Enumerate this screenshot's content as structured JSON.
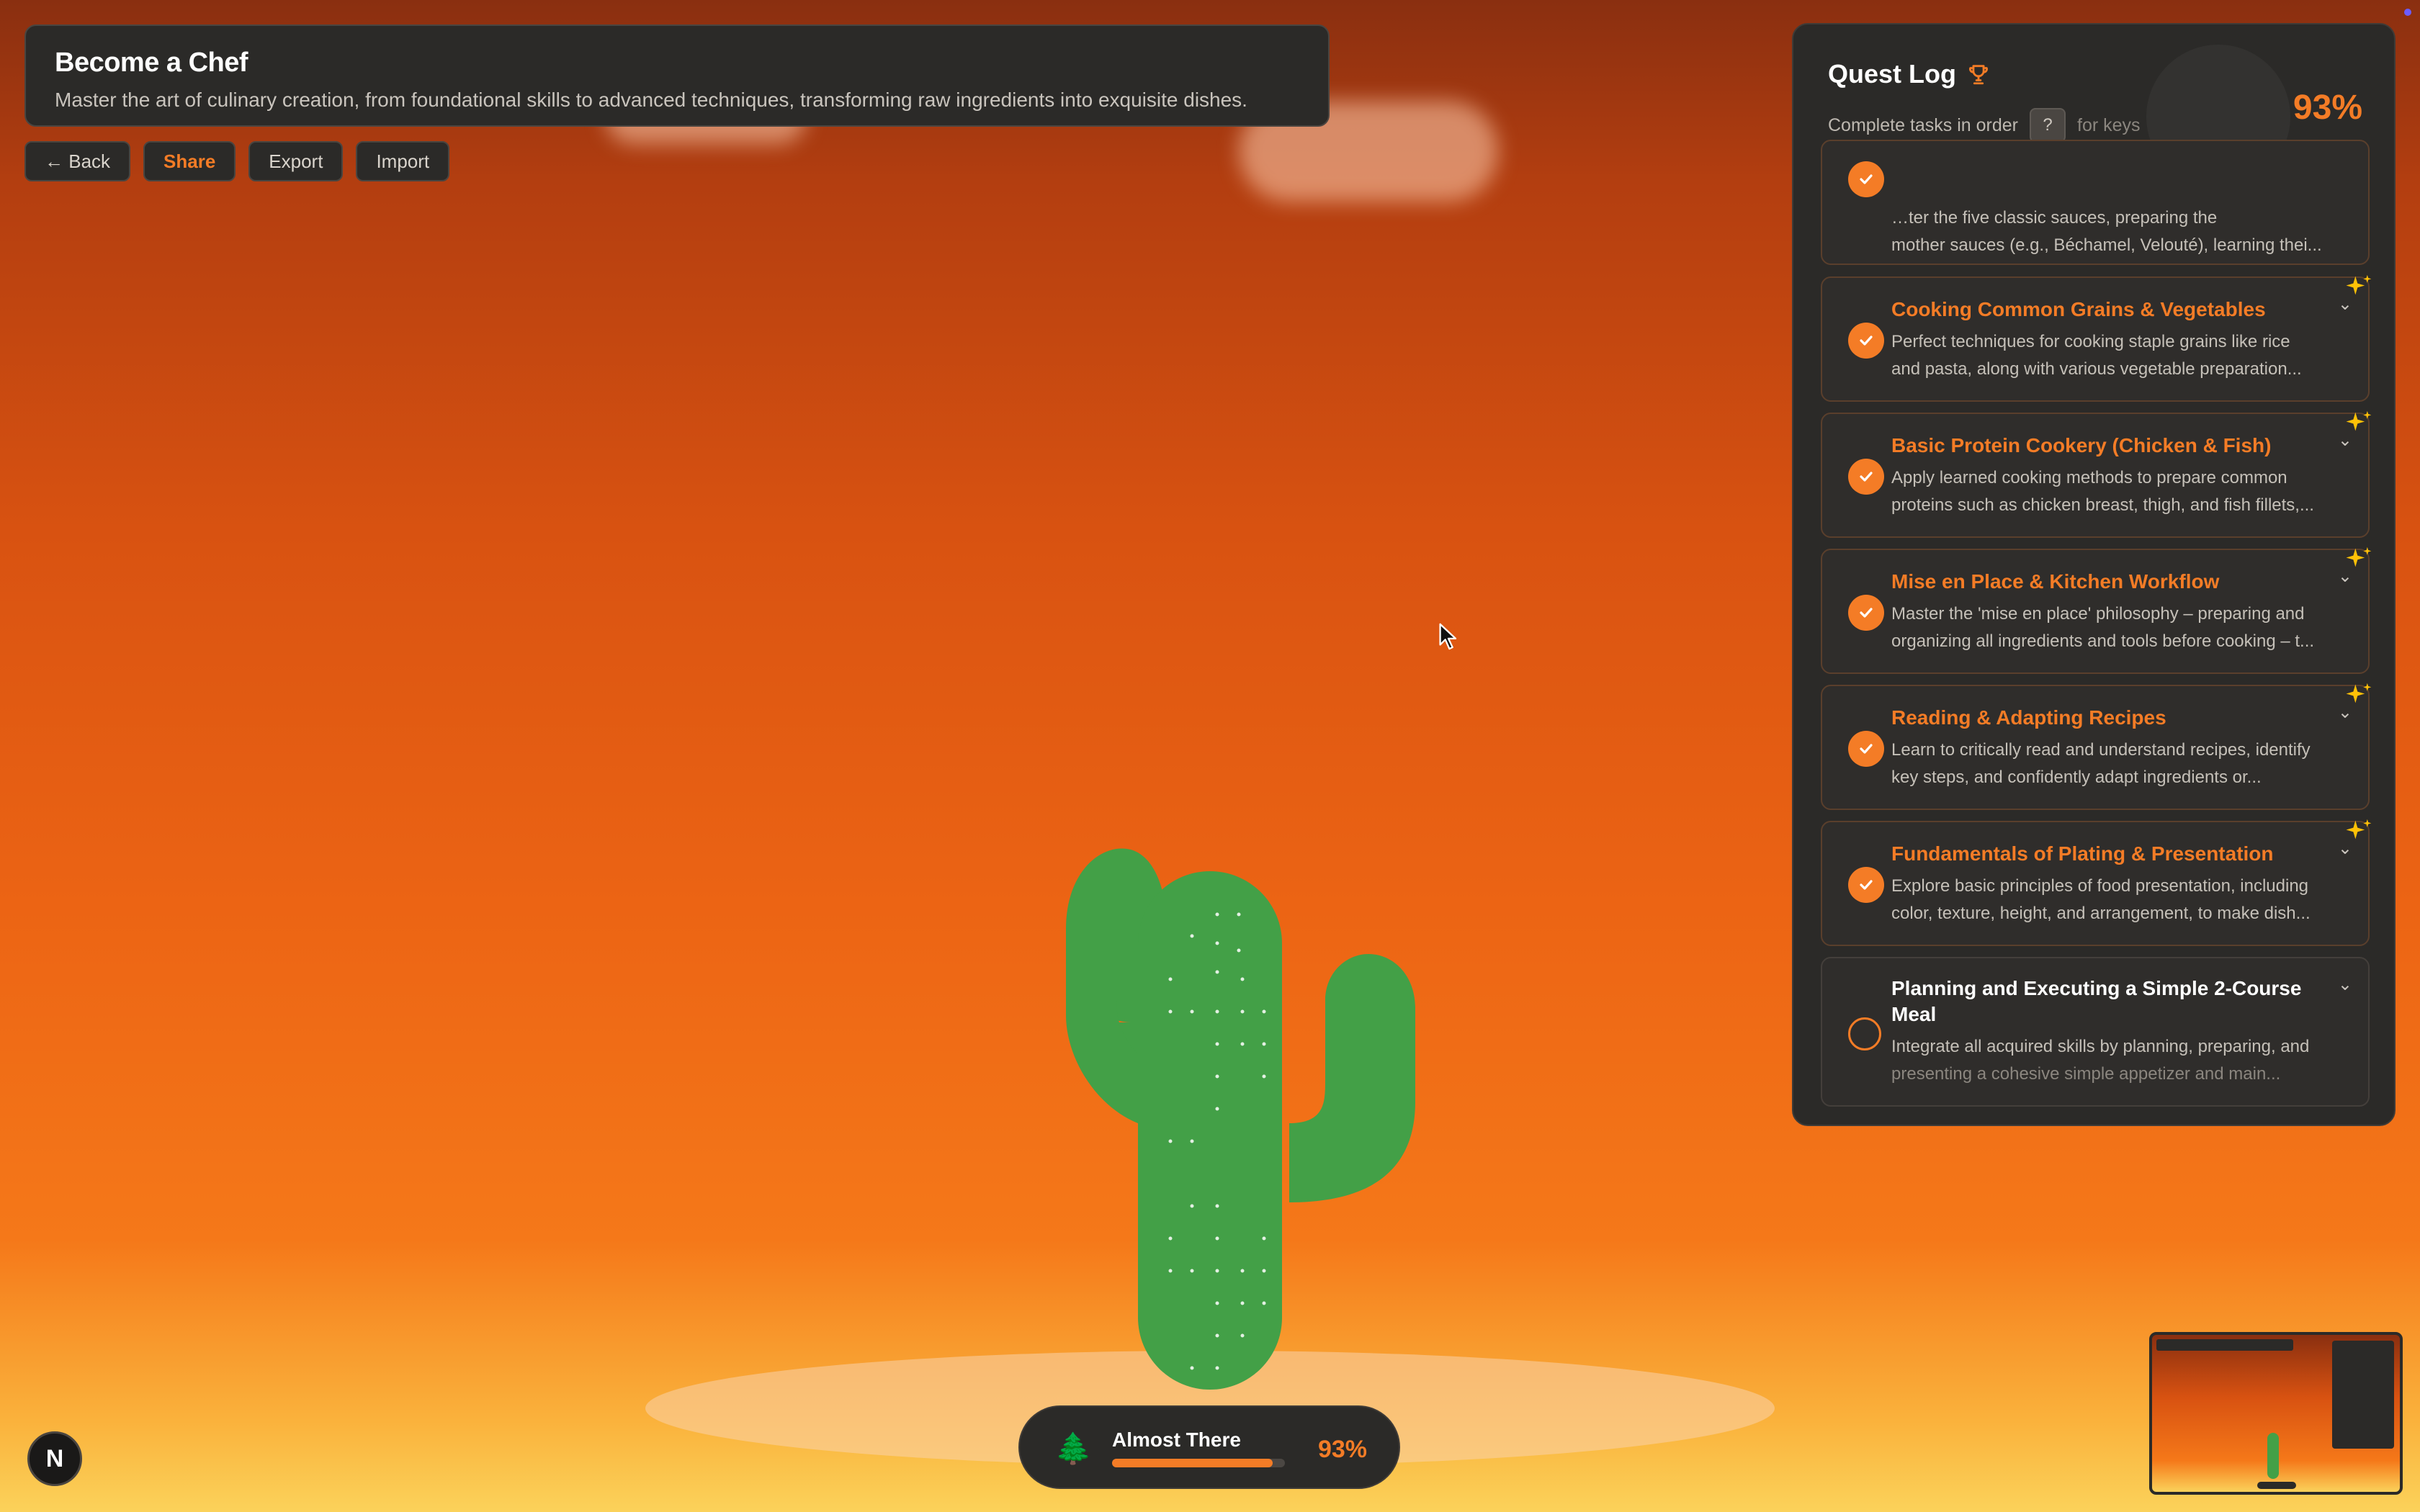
{
  "header": {
    "title": "Become a Chef",
    "subtitle": "Master the art of culinary creation, from foundational skills to advanced techniques, transforming raw ingredients into exquisite dishes."
  },
  "toolbar": {
    "back_label": "← Back",
    "share_label": "Share",
    "export_label": "Export",
    "import_label": "Import"
  },
  "quest_log": {
    "title": "Quest Log",
    "title_icon": "trophy-icon",
    "subtitle_before": "Complete tasks in order",
    "key_label": "?",
    "subtitle_after": "for keys",
    "progress_label": "93%",
    "progress_value": 0.93,
    "items": [
      {
        "title": "",
        "desc_lines": [
          "…ter the five classic sauces, preparing the",
          "mother sauces (e.g., Béchamel, Velouté), learning thei..."
        ],
        "status": "done",
        "sparkle": false
      },
      {
        "title": "Cooking Common Grains & Vegetables",
        "desc_lines": [
          "Perfect techniques for cooking staple grains like rice",
          "and pasta, along with various vegetable preparation..."
        ],
        "status": "done",
        "sparkle": true
      },
      {
        "title": "Basic Protein Cookery (Chicken & Fish)",
        "desc_lines": [
          "Apply learned cooking methods to prepare common",
          "proteins such as chicken breast, thigh, and fish fillets,..."
        ],
        "status": "done",
        "sparkle": true
      },
      {
        "title": "Mise en Place & Kitchen Workflow",
        "desc_lines": [
          "Master the 'mise en place' philosophy – preparing and",
          "organizing all ingredients and tools before cooking – t..."
        ],
        "status": "done",
        "sparkle": true
      },
      {
        "title": "Reading & Adapting Recipes",
        "desc_lines": [
          "Learn to critically read and understand recipes, identify",
          "key steps, and confidently adapt ingredients or..."
        ],
        "status": "done",
        "sparkle": true
      },
      {
        "title": "Fundamentals of Plating & Presentation",
        "desc_lines": [
          "Explore basic principles of food presentation, including",
          "color, texture, height, and arrangement, to make dish..."
        ],
        "status": "done",
        "sparkle": true
      },
      {
        "title": "Planning and Executing a Simple 2-Course Meal",
        "desc_lines": [
          "Integrate all acquired skills by planning, preparing, and",
          "presenting a cohesive simple appetizer and main..."
        ],
        "status": "todo",
        "sparkle": false
      }
    ]
  },
  "status_pill": {
    "icon": "tree-icon",
    "label": "Almost There",
    "progress_value": 0.93,
    "progress_label": "93%"
  },
  "corner_logo": {
    "label": "N"
  },
  "colors": {
    "accent": "#f47c26",
    "panel": "#2b2a28",
    "cactus": "#43a047",
    "sparkle": "#ffc107"
  }
}
